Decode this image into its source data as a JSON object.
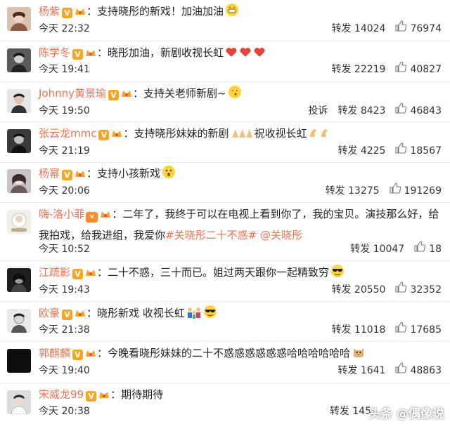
{
  "comments": [
    {
      "name": "杨紫",
      "text": "：支持晓彤的新戏！加油加油",
      "time": "今天 22:32",
      "repost_label": "转发",
      "reposts": "14024",
      "likes": "76974"
    },
    {
      "name": "陈学冬",
      "text": "：晓彤加油，新剧收视长虹",
      "time": "今天 19:41",
      "repost_label": "转发",
      "reposts": "22219",
      "likes": "40827"
    },
    {
      "name": "Johnny黄景瑜",
      "text": "：支持关老师新剧~",
      "time": "今天 19:50",
      "complain_label": "投诉",
      "repost_label": "转发",
      "reposts": "8423",
      "likes": "46843"
    },
    {
      "name": "张云龙mmc",
      "text": "：支持晓彤妹妹的新剧",
      "text2": "祝收视长虹",
      "time": "今天 21:19",
      "repost_label": "转发",
      "reposts": "4225",
      "likes": "18567"
    },
    {
      "name": "杨幂",
      "text": "：支持小孩新戏",
      "time": "今天 20:06",
      "repost_label": "转发",
      "reposts": "13275",
      "likes": "191269"
    },
    {
      "name": "嗨-洛小菲",
      "text": "：二年了，我终于可以在电视上看到你了，我的宝贝。演技那么好，给我拍戏，给我进组，我爱你",
      "tag1": "#关晓彤二十不惑#",
      "tag2": "@关晓彤",
      "time": "今天 10:52",
      "repost_label": "转发",
      "reposts": "10047",
      "likes": "18"
    },
    {
      "name": "江疏影",
      "text": "：二十不惑，三十而已。姐过两天跟你一起精致穷",
      "time": "今天 19:43",
      "repost_label": "转发",
      "reposts": "20550",
      "likes": "32352"
    },
    {
      "name": "欧豪",
      "text": "：晓彤新戏 收视长虹",
      "time": "今天 21:38",
      "repost_label": "转发",
      "reposts": "11018",
      "likes": "17685"
    },
    {
      "name": "郭麒麟",
      "text": "：今晚看晓彤妹妹的二十不惑惑惑惑惑惑哈哈哈哈哈哈",
      "time": "今天 19:40",
      "repost_label": "转发",
      "reposts": "1641",
      "likes": "48863"
    },
    {
      "name": "宋威龙99",
      "text": "：期待期待",
      "time": "今天 20:38",
      "repost_label": "转发",
      "reposts": "145",
      "likes": ""
    }
  ],
  "badges": {
    "verified": "V",
    "vip": "v"
  },
  "watermark": "头条 @偶像说",
  "colors": {
    "name": "#eb7350",
    "badge": "#f5a623",
    "divider": "#ececec"
  },
  "icons": {
    "like": "thumbs-up-icon",
    "verified": "verified-badge-icon",
    "vip": "vip-badge-icon"
  }
}
